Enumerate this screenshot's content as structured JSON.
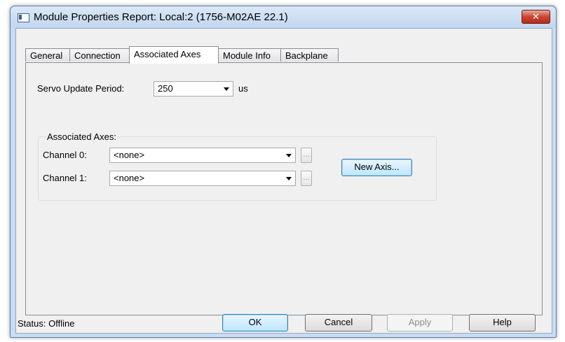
{
  "window": {
    "title": "Module Properties Report: Local:2 (1756-M02AE 22.1)",
    "close_glyph": "✕"
  },
  "tabs": [
    {
      "label": "General",
      "active": false
    },
    {
      "label": "Connection",
      "active": false
    },
    {
      "label": "Associated Axes",
      "active": true
    },
    {
      "label": "Module Info",
      "active": false
    },
    {
      "label": "Backplane",
      "active": false
    }
  ],
  "servo": {
    "label": "Servo Update Period:",
    "value": "250",
    "unit": "us"
  },
  "associated_axes": {
    "group_label": "Associated Axes:",
    "channel0_label": "Channel 0:",
    "channel0_value": "<none>",
    "channel1_label": "Channel 1:",
    "channel1_value": "<none>",
    "ellipsis_label": "...",
    "new_axis_label": "New Axis..."
  },
  "footer": {
    "status_label": "Status:",
    "status_value": "Offline",
    "ok_label": "OK",
    "cancel_label": "Cancel",
    "apply_label": "Apply",
    "help_label": "Help"
  },
  "colors": {
    "title_bar": "#c9dcf2",
    "close_button": "#c84533",
    "default_button": "#bee6fd"
  }
}
